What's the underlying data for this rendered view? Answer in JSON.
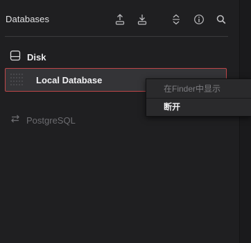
{
  "header": {
    "title": "Databases",
    "buttons": [
      {
        "name": "export-icon"
      },
      {
        "name": "import-icon"
      },
      {
        "name": "expand-collapse-icon"
      },
      {
        "name": "info-icon"
      },
      {
        "name": "search-icon"
      }
    ]
  },
  "sections": {
    "disk": {
      "label": "Disk",
      "icon": "disk-drive-icon"
    },
    "postgres": {
      "label": "PostgreSQL",
      "icon": "swap-arrows-icon"
    }
  },
  "database_item": {
    "name": "Local Database",
    "selected": true,
    "accent": "#c0474a"
  },
  "context_menu": {
    "items": [
      {
        "label": "在Finder中显示",
        "enabled": false
      },
      {
        "label": "断开",
        "enabled": true
      }
    ]
  },
  "colors": {
    "background": "#1f1f21",
    "selected_row": "#343437",
    "menu_background": "#2a2a2c"
  }
}
